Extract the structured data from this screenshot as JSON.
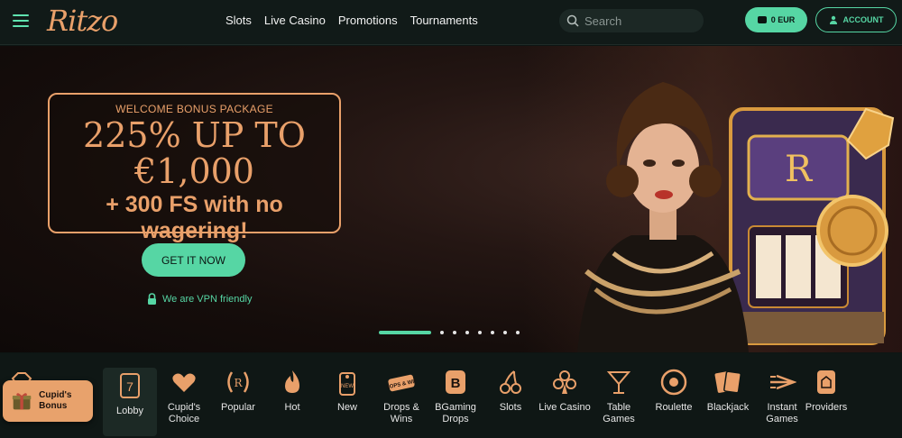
{
  "header": {
    "logo": "Ritzo",
    "nav": [
      "Slots",
      "Live Casino",
      "Promotions",
      "Tournaments"
    ],
    "search_placeholder": "Search",
    "balance": "0 EUR",
    "account_label": "ACCOUNT"
  },
  "hero": {
    "eyebrow": "WELCOME BONUS PACKAGE",
    "line1": "225% UP TO",
    "line2": "€1,000",
    "line3": "+ 300 FS with no wagering!",
    "cta": "GET IT NOW",
    "vpn_note": "We are VPN friendly",
    "slides_total": 8,
    "slide_active": 1,
    "slot_letter": "R"
  },
  "categories": [
    {
      "label": "Lobby"
    },
    {
      "label": "Cupid's Choice"
    },
    {
      "label": "Popular"
    },
    {
      "label": "Hot"
    },
    {
      "label": "New"
    },
    {
      "label": "Drops & Wins"
    },
    {
      "label": "BGaming Drops"
    },
    {
      "label": "Slots"
    },
    {
      "label": "Live Casino"
    },
    {
      "label": "Table Games"
    },
    {
      "label": "Roulette"
    },
    {
      "label": "Blackjack"
    },
    {
      "label": "Instant Games"
    },
    {
      "label": "Providers"
    }
  ],
  "icon_badges": {
    "new": "NEW",
    "drops": "DROPS & WINS",
    "bgaming": "B",
    "lobby_digit": "7",
    "popular_letter": "R"
  },
  "cupid_bonus": "Cupid's Bonus",
  "colors": {
    "accent": "#56d6a4",
    "gold": "#e9a06a",
    "bg": "#0d1513"
  }
}
